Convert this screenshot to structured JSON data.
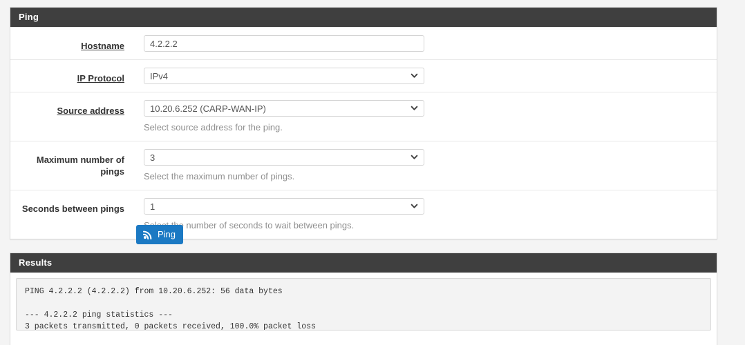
{
  "ping_panel": {
    "title": "Ping",
    "fields": [
      {
        "label": "Hostname",
        "type": "text",
        "value": "4.2.2.2",
        "placeholder": "",
        "help": ""
      },
      {
        "label": "IP Protocol",
        "type": "select",
        "value": "IPv4",
        "help": ""
      },
      {
        "label": "Source address",
        "type": "select",
        "value": "10.20.6.252 (CARP-WAN-IP)",
        "help": "Select source address for the ping."
      },
      {
        "label": "Maximum number of pings",
        "type": "select",
        "value": "3",
        "help": "Select the maximum number of pings."
      },
      {
        "label": "Seconds between pings",
        "type": "select",
        "value": "1",
        "help": "Select the number of seconds to wait between pings."
      }
    ]
  },
  "actions": {
    "ping_label": "Ping",
    "ping_icon": "signal-wave-icon"
  },
  "results_panel": {
    "title": "Results",
    "output": "PING 4.2.2.2 (4.2.2.2) from 10.20.6.252: 56 data bytes\n\n--- 4.2.2.2 ping statistics ---\n3 packets transmitted, 0 packets received, 100.0% packet loss"
  },
  "colors": {
    "panel_heading_bg": "#3f3f3f",
    "button_primary": "#1b79c3",
    "page_bg": "#f4f4f4",
    "help_text": "#8f8f8f"
  }
}
